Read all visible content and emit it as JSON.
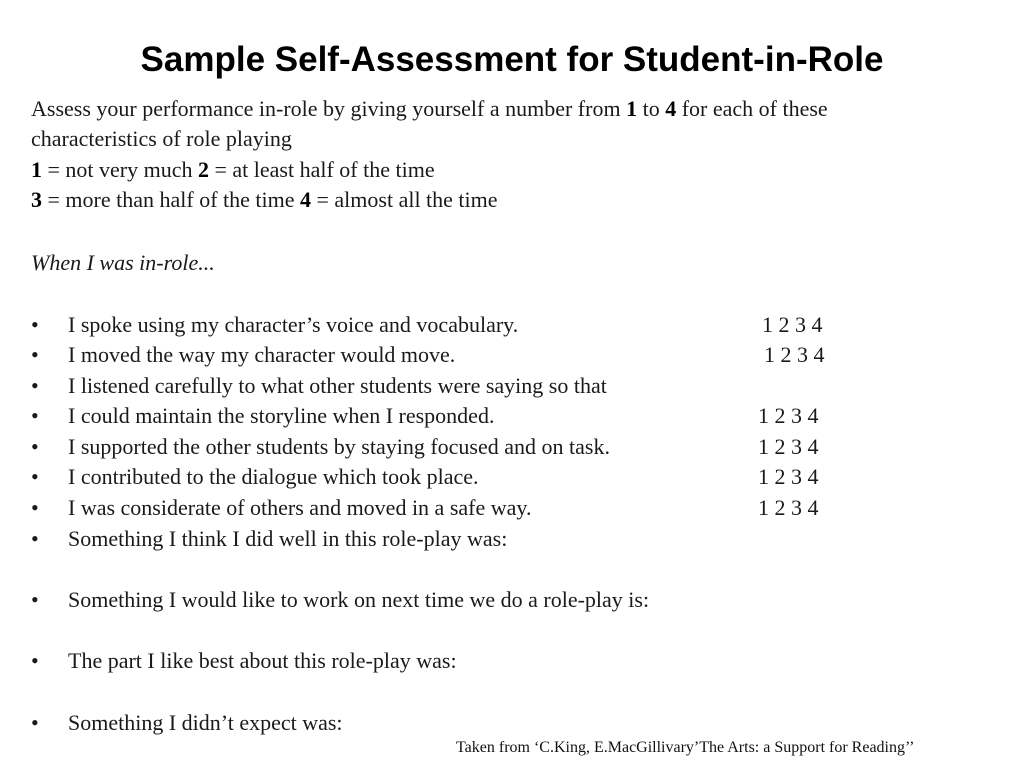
{
  "title": "Sample Self-Assessment for Student-in-Role",
  "intro": {
    "line1_a": "Assess your performance in-role by giving  yourself a number from ",
    "line1_b1": "1",
    "line1_mid": " to ",
    "line1_b2": "4",
    "line1_c": " for each of these",
    "line2": "characteristics of role playing",
    "scale_line1": {
      "n1": "1",
      "t1": " = not very much ",
      "n2": "2",
      "t2": " = at least half of the time"
    },
    "scale_line2": {
      "n3": "3",
      "t3": " = more than half of the time ",
      "n4": "4",
      "t4": " = almost all the time"
    }
  },
  "prompt": "When I was in-role...",
  "bullet_symbol": "•",
  "items": [
    {
      "text": "I spoke using my character’s voice and vocabulary.",
      "scale": "1 2 3 4"
    },
    {
      "text": "I moved the way my character would move.",
      "scale": "1 2 3 4"
    },
    {
      "text": "I listened carefully to what other students were saying so that",
      "scale": ""
    },
    {
      "text": "I could maintain the storyline when I responded.",
      "scale": "1 2 3 4"
    },
    {
      "text": "I supported the other students by staying focused and on task.",
      "scale": "1 2 3 4"
    },
    {
      "text": "I contributed to the dialogue which took place.",
      "scale": "1 2 3 4"
    },
    {
      "text": "I was considerate of others and moved in a safe way.",
      "scale": "1 2 3 4"
    },
    {
      "text": "Something I think I did well in this role-play was:",
      "scale": ""
    },
    {
      "text": "Something I would like to work on next time we do a role-play is:",
      "scale": ""
    },
    {
      "text": "The part I like best about this role-play was:",
      "scale": ""
    },
    {
      "text": "Something I didn’t expect was:",
      "scale": ""
    }
  ],
  "footer": "Taken from ‘C.King,  E.MacGillivary’The  Arts: a Support for Reading’’"
}
